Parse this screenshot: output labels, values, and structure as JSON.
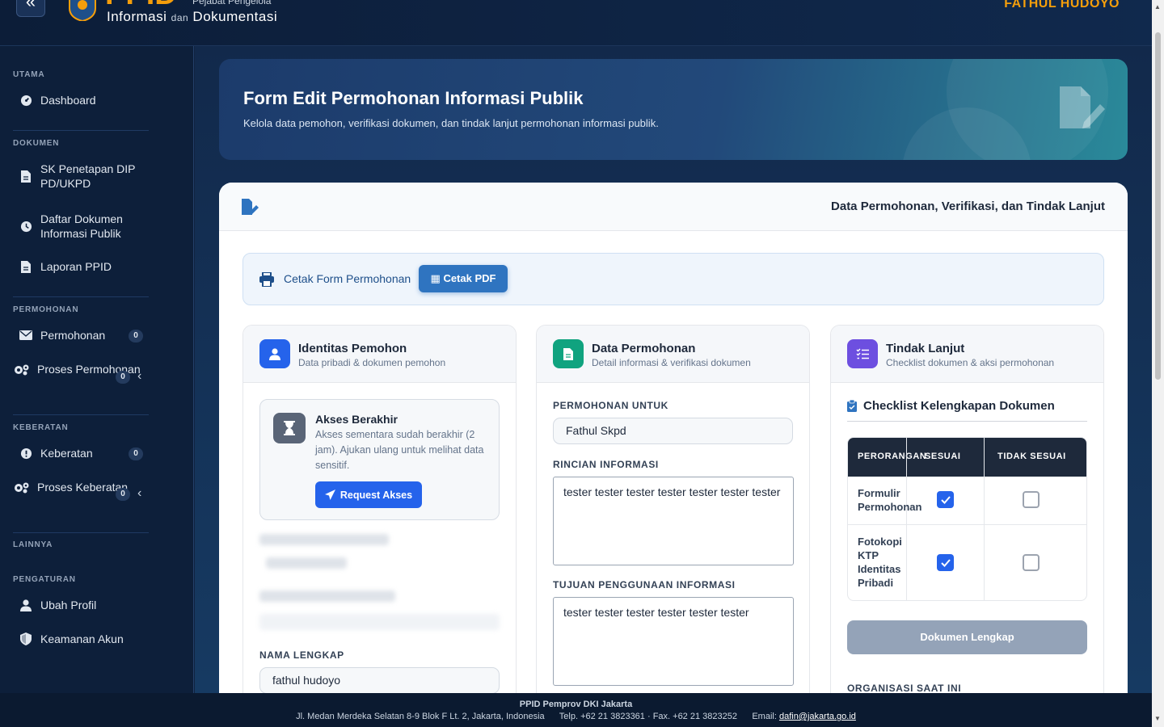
{
  "header": {
    "logo_big": "PPID",
    "logo_sub1": "Pejabat Pengelola",
    "logo_sub2a": "Informasi",
    "logo_sub2_dan": "dan",
    "logo_sub2b": "Dokumentasi",
    "user_name": "FATHUL HUDOYO"
  },
  "sidebar": {
    "sections": {
      "utama": "UTAMA",
      "dokumen": "DOKUMEN",
      "permohonan": "PERMOHONAN",
      "keberatan": "KEBERATAN",
      "lainnya": "LAINNYA",
      "pengaturan": "PENGATURAN"
    },
    "items": {
      "dashboard": "Dashboard",
      "sk": "SK Penetapan DIP PD/UKPD",
      "daftar": "Daftar Dokumen Informasi Publik",
      "laporan": "Laporan PPID",
      "permohonan": "Permohonan",
      "proses_permohonan": "Proses Permohonan",
      "keberatan": "Keberatan",
      "proses_keberatan": "Proses Keberatan",
      "ubah_profil": "Ubah Profil",
      "keamanan": "Keamanan Akun"
    },
    "badges": {
      "permohonan": "0",
      "proses_permohonan": "0",
      "keberatan": "0",
      "proses_keberatan": "0"
    }
  },
  "hero": {
    "title": "Form Edit Permohonan Informasi Publik",
    "subtitle": "Kelola data pemohon, verifikasi dokumen, dan tindak lanjut permohonan informasi publik."
  },
  "card": {
    "title": "Data Permohonan, Verifikasi, dan Tindak Lanjut",
    "print_label": "Cetak Form Permohonan",
    "pdf_label": "Cetak PDF"
  },
  "identitas": {
    "title": "Identitas Pemohon",
    "subtitle": "Data pribadi & dokumen pemohon",
    "access_title": "Akses Berakhir",
    "access_text": "Akses sementara sudah berakhir (2 jam). Ajukan ulang untuk melihat data sensitif.",
    "access_button": "Request Akses",
    "nama_label": "NAMA LENGKAP",
    "nama_value": "fathul hudoyo"
  },
  "data_permohonan": {
    "title": "Data Permohonan",
    "subtitle": "Detail informasi & verifikasi dokumen",
    "untuk_label": "PERMOHONAN UNTUK",
    "untuk_value": "Fathul Skpd",
    "rincian_label": "RINCIAN INFORMASI",
    "rincian_value": "tester tester tester tester tester tester tester",
    "tujuan_label": "TUJUAN PENGGUNAAN INFORMASI",
    "tujuan_value": "tester tester tester tester tester tester"
  },
  "tindak_lanjut": {
    "title": "Tindak Lanjut",
    "subtitle": "Checklist dokumen & aksi permohonan",
    "checklist_title": "Checklist Kelengkapan Dokumen",
    "columns": [
      "PERORANGAN",
      "SESUAI",
      "TIDAK SESUAI"
    ],
    "rows": [
      {
        "doc": "Formulir Permohonan",
        "sesuai": true,
        "tidak_sesuai": false
      },
      {
        "doc": "Fotokopi KTP Identitas Pribadi",
        "sesuai": true,
        "tidak_sesuai": false
      }
    ],
    "done_button": "Dokumen Lengkap",
    "org_label": "ORGANISASI SAAT INI"
  },
  "footer": {
    "org": "PPID Pemprov DKI Jakarta",
    "address": "Jl. Medan Merdeka Selatan 8-9 Blok F Lt. 2, Jakarta, Indonesia",
    "phone": "Telp. +62 21 3823361 · Fax. +62 21 3823252",
    "email_label": "Email:",
    "email": "dafin@jakarta.go.id"
  },
  "colors": {
    "accent": "#2563eb",
    "brand_orange": "#f59e0b",
    "sidebar_bg": "#0d1f3a"
  }
}
